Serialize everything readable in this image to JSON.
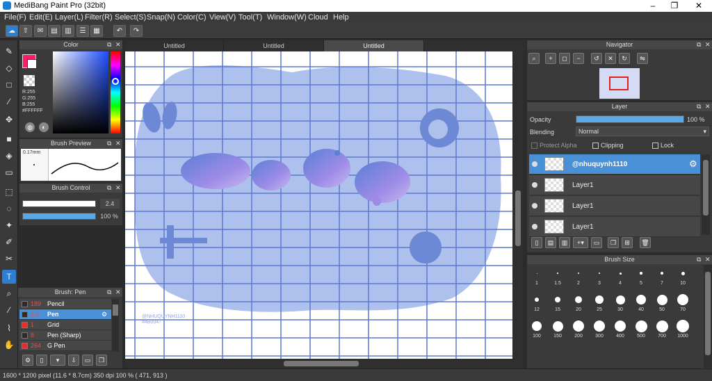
{
  "window": {
    "title": "MediBang Paint Pro (32bit)",
    "minimize": "–",
    "maximize": "❐",
    "close": "✕"
  },
  "menu": [
    "File(F)",
    "Edit(E)",
    "Layer(L)",
    "Filter(R)",
    "Select(S)",
    "Snap(N)",
    "Color(C)",
    "View(V)",
    "Tool(T)",
    "Window(W)",
    "Cloud",
    "Help"
  ],
  "tabs": [
    "Untitled",
    "Untitled",
    "Untitled"
  ],
  "color_panel": {
    "title": "Color",
    "r": "R:255",
    "g": "G:255",
    "b": "B:255",
    "hex": "#FFFFFF",
    "primary": "#ff1a6a",
    "secondary": "#ffffff"
  },
  "brush_preview": {
    "title": "Brush Preview",
    "size": "0.17mm"
  },
  "brush_control": {
    "title": "Brush Control",
    "size_value": "2.4",
    "opacity_value": "100 %",
    "size_fill": 1.0,
    "opacity_fill": 1.0
  },
  "brush_list": {
    "title": "Brush: Pen",
    "items": [
      {
        "num": "189",
        "name": "Pencil",
        "color": "#2b2b2b"
      },
      {
        "num": "2.4",
        "name": "Pen",
        "color": "#2b2b2b"
      },
      {
        "num": "1",
        "name": "Grid",
        "color": "#e03030"
      },
      {
        "num": "8",
        "name": "Pen (Sharp)",
        "color": "#2b2b2b"
      },
      {
        "num": "264",
        "name": "G Pen",
        "color": "#e03030"
      }
    ]
  },
  "navigator": {
    "title": "Navigator"
  },
  "layer_panel": {
    "title": "Layer",
    "opacity_label": "Opacity",
    "opacity_value": "100 %",
    "opacity_fill": 1.0,
    "blending_label": "Blending",
    "blending_value": "Normal",
    "protect_alpha": "Protect Alpha",
    "clipping": "Clipping",
    "lock": "Lock",
    "layers": [
      "@nhuquynh1110",
      "Layer1",
      "Layer1",
      "Layer1"
    ]
  },
  "brush_size": {
    "title": "Brush Size",
    "sizes": [
      "1",
      "1.5",
      "2",
      "3",
      "4",
      "5",
      "7",
      "10",
      "12",
      "15",
      "20",
      "25",
      "30",
      "40",
      "50",
      "70",
      "100",
      "150",
      "200",
      "300",
      "400",
      "500",
      "700",
      "1000"
    ]
  },
  "canvas": {
    "watermark_line1": "@NHUQUYNH1110",
    "watermark_line2": "#4B0047"
  },
  "status": {
    "text": "1600 * 1200 pixel   (11.6 * 8.7cm)   350 dpi   100 %   ( 471, 913 )"
  }
}
